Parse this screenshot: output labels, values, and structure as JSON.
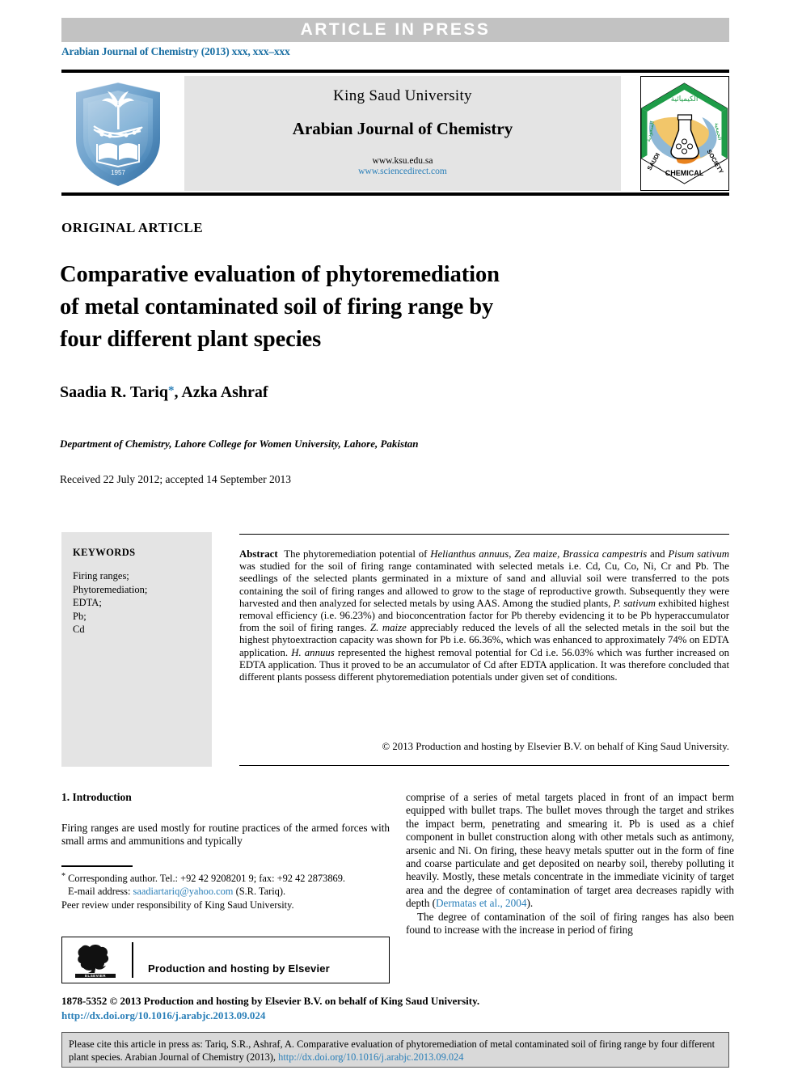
{
  "banner": {
    "article_in_press": "ARTICLE  IN  PRESS",
    "journal_reference": "Arabian Journal of Chemistry (2013) xxx, xxx–xxx"
  },
  "masthead": {
    "university": "King Saud University",
    "journal_title": "Arabian Journal of Chemistry",
    "url_ksu": "www.ksu.edu.sa",
    "url_sciencedirect": "www.sciencedirect.com",
    "left_logo_alt": "King Saud University",
    "right_logo_alt": "Saudi Chemical Society",
    "scs_top_arabic": "الكيميائية",
    "scs_bottom": "CHEMICAL",
    "scs_left": "SAUDI",
    "scs_right": "SOCIETY"
  },
  "article": {
    "type_label": "ORIGINAL ARTICLE",
    "title_line1": "Comparative evaluation of phytoremediation",
    "title_line2": "of metal contaminated soil of firing range by",
    "title_line3": "four different plant species",
    "authors": "Saadia R. Tariq",
    "authors_rest": ", Azka Ashraf",
    "corresponding_marker": "*",
    "affiliation": "Department of Chemistry, Lahore College for Women University, Lahore, Pakistan",
    "dates": "Received 22 July 2012; accepted 14 September 2013"
  },
  "keywords": {
    "heading": "KEYWORDS",
    "items": [
      "Firing ranges;",
      "Phytoremediation;",
      "EDTA;",
      "Pb;",
      "Cd"
    ]
  },
  "abstract": {
    "label": "Abstract",
    "text_part1": "The phytoremediation potential of ",
    "sp1": "Helianthus annuus",
    "text_part2": ", ",
    "sp2": "Zea maize",
    "text_part3": ", ",
    "sp3": "Brassica campestris",
    "text_part4": " and ",
    "sp4": "Pisum sativum",
    "text_part5": " was studied for the soil of firing range contaminated with selected metals i.e. Cd, Cu, Co, Ni, Cr and Pb. The seedlings of the selected plants germinated in a mixture of sand and alluvial soil were transferred to the pots containing the soil of firing ranges and allowed to grow to the stage of reproductive growth. Subsequently they were harvested and then analyzed for selected metals by using AAS. Among the studied plants, ",
    "sp5": "P. sativum",
    "text_part6": " exhibited highest removal efficiency (i.e. 96.23%) and bioconcentration factor for Pb thereby evidencing it to be Pb hyperaccumulator from the soil of firing ranges. ",
    "sp6": "Z. maize",
    "text_part7": " appreciably reduced the levels of all the selected metals in the soil but the highest phytoextraction capacity was shown for Pb i.e. 66.36%, which was enhanced to approximately 74% on EDTA application. ",
    "sp7": "H. annuus",
    "text_part8": " represented the highest removal potential for Cd i.e. 56.03% which was further increased on EDTA application. Thus it proved to be an accumulator of Cd after EDTA application. It was therefore concluded that different plants possess different phytoremediation potentials under given set of conditions.",
    "copyright": "© 2013 Production and hosting by Elsevier B.V. on behalf of King Saud University."
  },
  "body": {
    "section1_heading": "1. Introduction",
    "left_paragraph1": "Firing ranges are used mostly for routine practices of the armed forces with small arms and ammunitions and typically",
    "right_paragraph1": "comprise of a series of metal targets placed in front of an impact berm equipped with bullet traps. The bullet moves through the target and strikes the impact berm, penetrating and smearing it. Pb is used as a chief component in bullet construction along with other metals such as antimony, arsenic and Ni. On firing, these heavy metals sputter out in the form of fine and coarse particulate and get deposited on nearby soil, thereby polluting it heavily. Mostly, these metals concentrate in the immediate vicinity of target area and the degree of contamination of target area decreases rapidly with depth (",
    "right_citation": "Dermatas et al., 2004",
    "right_paragraph1_end": ").",
    "right_paragraph2": "The degree of contamination of the soil of firing ranges has also been found to increase with the increase in period of firing"
  },
  "footnotes": {
    "corresponding_star": "*",
    "corresponding": "Corresponding author. Tel.: +92 42 9208201 9; fax: +92 42 2873869.",
    "email_label": "E-mail address:",
    "email": "saadiartariq@yahoo.com",
    "email_suffix": "(S.R. Tariq).",
    "peer_review": "Peer review under responsibility of King Saud University.",
    "elsevier_text": "Production and hosting by Elsevier",
    "elsevier_wordmark": "ELSEVIER"
  },
  "footer": {
    "issn_line": "1878-5352 © 2013 Production and hosting by Elsevier B.V. on behalf of King Saud University.",
    "doi": "http://dx.doi.org/10.1016/j.arabjc.2013.09.024",
    "citation_part1": "Please cite this article in press as: Tariq, S.R., Ashraf, A. Comparative evaluation of phytoremediation of metal contaminated soil of firing range by four different plant species. Arabian Journal of Chemistry (2013), ",
    "citation_doi": "http://dx.doi.org/10.1016/j.arabjc.2013.09.024"
  },
  "colors": {
    "band_gray": "#c2c2c2",
    "link_blue": "#2a7fb8",
    "box_gray": "#e4e4e4",
    "cite_gray": "#d9d9d9"
  }
}
